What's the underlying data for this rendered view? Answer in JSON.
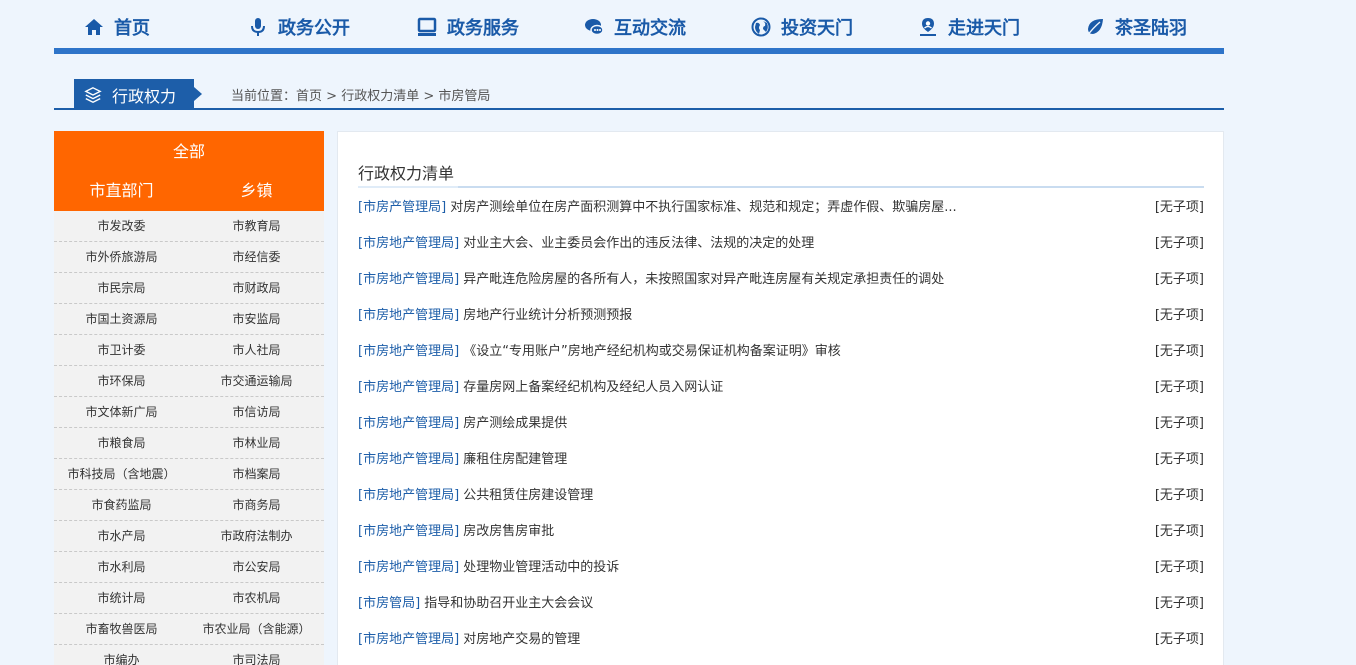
{
  "nav": {
    "items": [
      {
        "label": "首页",
        "icon": "home-icon"
      },
      {
        "label": "政务公开",
        "icon": "microphone-icon"
      },
      {
        "label": "政务服务",
        "icon": "monitor-icon"
      },
      {
        "label": "互动交流",
        "icon": "chat-icon"
      },
      {
        "label": "投资天门",
        "icon": "globe-icon"
      },
      {
        "label": "走进天门",
        "icon": "location-user-icon"
      },
      {
        "label": "茶圣陆羽",
        "icon": "leaf-icon"
      }
    ]
  },
  "section": {
    "title": "行政权力",
    "icon": "layers-icon"
  },
  "breadcrumb": {
    "prefix": "当前位置：",
    "items": [
      "首页",
      "行政权力清单",
      "市房管局"
    ],
    "separator": " > "
  },
  "sidebar": {
    "all_label": "全部",
    "tabs": [
      "市直部门",
      "乡镇"
    ],
    "rows": [
      [
        "市发改委",
        "市教育局"
      ],
      [
        "市外侨旅游局",
        "市经信委"
      ],
      [
        "市民宗局",
        "市财政局"
      ],
      [
        "市国土资源局",
        "市安监局"
      ],
      [
        "市卫计委",
        "市人社局"
      ],
      [
        "市环保局",
        "市交通运输局"
      ],
      [
        "市文体新广局",
        "市信访局"
      ],
      [
        "市粮食局",
        "市林业局"
      ],
      [
        "市科技局（含地震）",
        "市档案局"
      ],
      [
        "市食药监局",
        "市商务局"
      ],
      [
        "市水产局",
        "市政府法制办"
      ],
      [
        "市水利局",
        "市公安局"
      ],
      [
        "市统计局",
        "市农机局"
      ],
      [
        "市畜牧兽医局",
        "市农业局（含能源）"
      ],
      [
        "市编办",
        "市司法局"
      ]
    ]
  },
  "main": {
    "title": "行政权力清单",
    "items": [
      {
        "dept": "[市房产管理局]",
        "text": "对房产测绘单位在房产面积测算中不执行国家标准、规范和规定；弄虚作假、欺骗房屋...",
        "tag": "[无子项]"
      },
      {
        "dept": "[市房地产管理局]",
        "text": "对业主大会、业主委员会作出的违反法律、法规的决定的处理",
        "tag": "[无子项]"
      },
      {
        "dept": "[市房地产管理局]",
        "text": "异产毗连危险房屋的各所有人，未按照国家对异产毗连房屋有关规定承担责任的调处",
        "tag": "[无子项]"
      },
      {
        "dept": "[市房地产管理局]",
        "text": "房地产行业统计分析预测预报",
        "tag": "[无子项]"
      },
      {
        "dept": "[市房地产管理局]",
        "text": "《设立“专用账户”房地产经纪机构或交易保证机构备案证明》审核",
        "tag": "[无子项]"
      },
      {
        "dept": "[市房地产管理局]",
        "text": "存量房网上备案经纪机构及经纪人员入网认证",
        "tag": "[无子项]"
      },
      {
        "dept": "[市房地产管理局]",
        "text": "房产测绘成果提供",
        "tag": "[无子项]"
      },
      {
        "dept": "[市房地产管理局]",
        "text": "廉租住房配建管理",
        "tag": "[无子项]"
      },
      {
        "dept": "[市房地产管理局]",
        "text": "公共租赁住房建设管理",
        "tag": "[无子项]"
      },
      {
        "dept": "[市房地产管理局]",
        "text": "房改房售房审批",
        "tag": "[无子项]"
      },
      {
        "dept": "[市房地产管理局]",
        "text": "处理物业管理活动中的投诉",
        "tag": "[无子项]"
      },
      {
        "dept": "[市房管局]",
        "text": "指导和协助召开业主大会会议",
        "tag": "[无子项]"
      },
      {
        "dept": "[市房地产管理局]",
        "text": "对房地产交易的管理",
        "tag": "[无子项]"
      }
    ]
  },
  "colors": {
    "accent_blue": "#1d5ea9",
    "nav_blue": "#2e74c9",
    "orange": "#ff6600"
  }
}
